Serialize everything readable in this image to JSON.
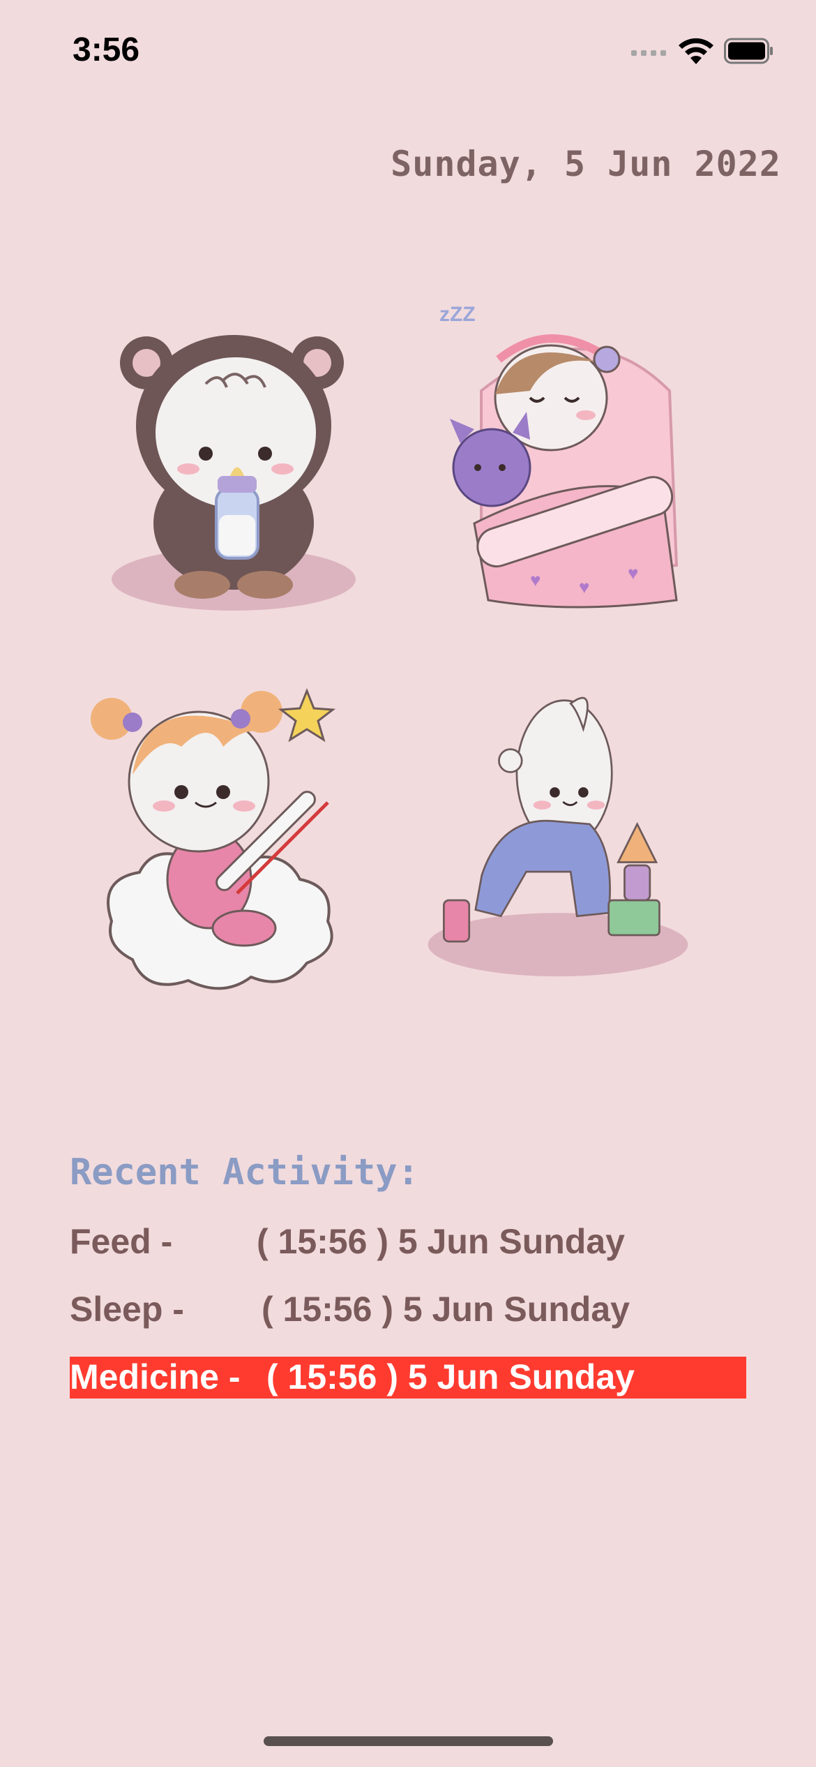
{
  "status_bar": {
    "time": "3:56"
  },
  "header": {
    "date": "Sunday, 5 Jun 2022"
  },
  "tiles": [
    {
      "name": "feed",
      "icon": "baby-bottle-icon"
    },
    {
      "name": "sleep",
      "icon": "sleeping-baby-icon",
      "sleep_text": "zZZ"
    },
    {
      "name": "medicine",
      "icon": "thermometer-baby-icon"
    },
    {
      "name": "play",
      "icon": "crawling-baby-blocks-icon"
    }
  ],
  "recent": {
    "title": "Recent Activity:",
    "items": [
      {
        "label": "Feed -",
        "time": "( 15:56 ) 5 Jun Sunday",
        "highlight": false
      },
      {
        "label": "Sleep -",
        "time": "( 15:56 ) 5 Jun Sunday",
        "highlight": false
      },
      {
        "label": "Medicine -",
        "time": "( 15:56 ) 5 Jun Sunday",
        "highlight": true
      }
    ]
  },
  "colors": {
    "background": "#f2dbdd",
    "date_text": "#7d6363",
    "recent_title": "#8a9bc4",
    "activity_text": "#7a5a5a",
    "highlight": "#ff3b30"
  }
}
